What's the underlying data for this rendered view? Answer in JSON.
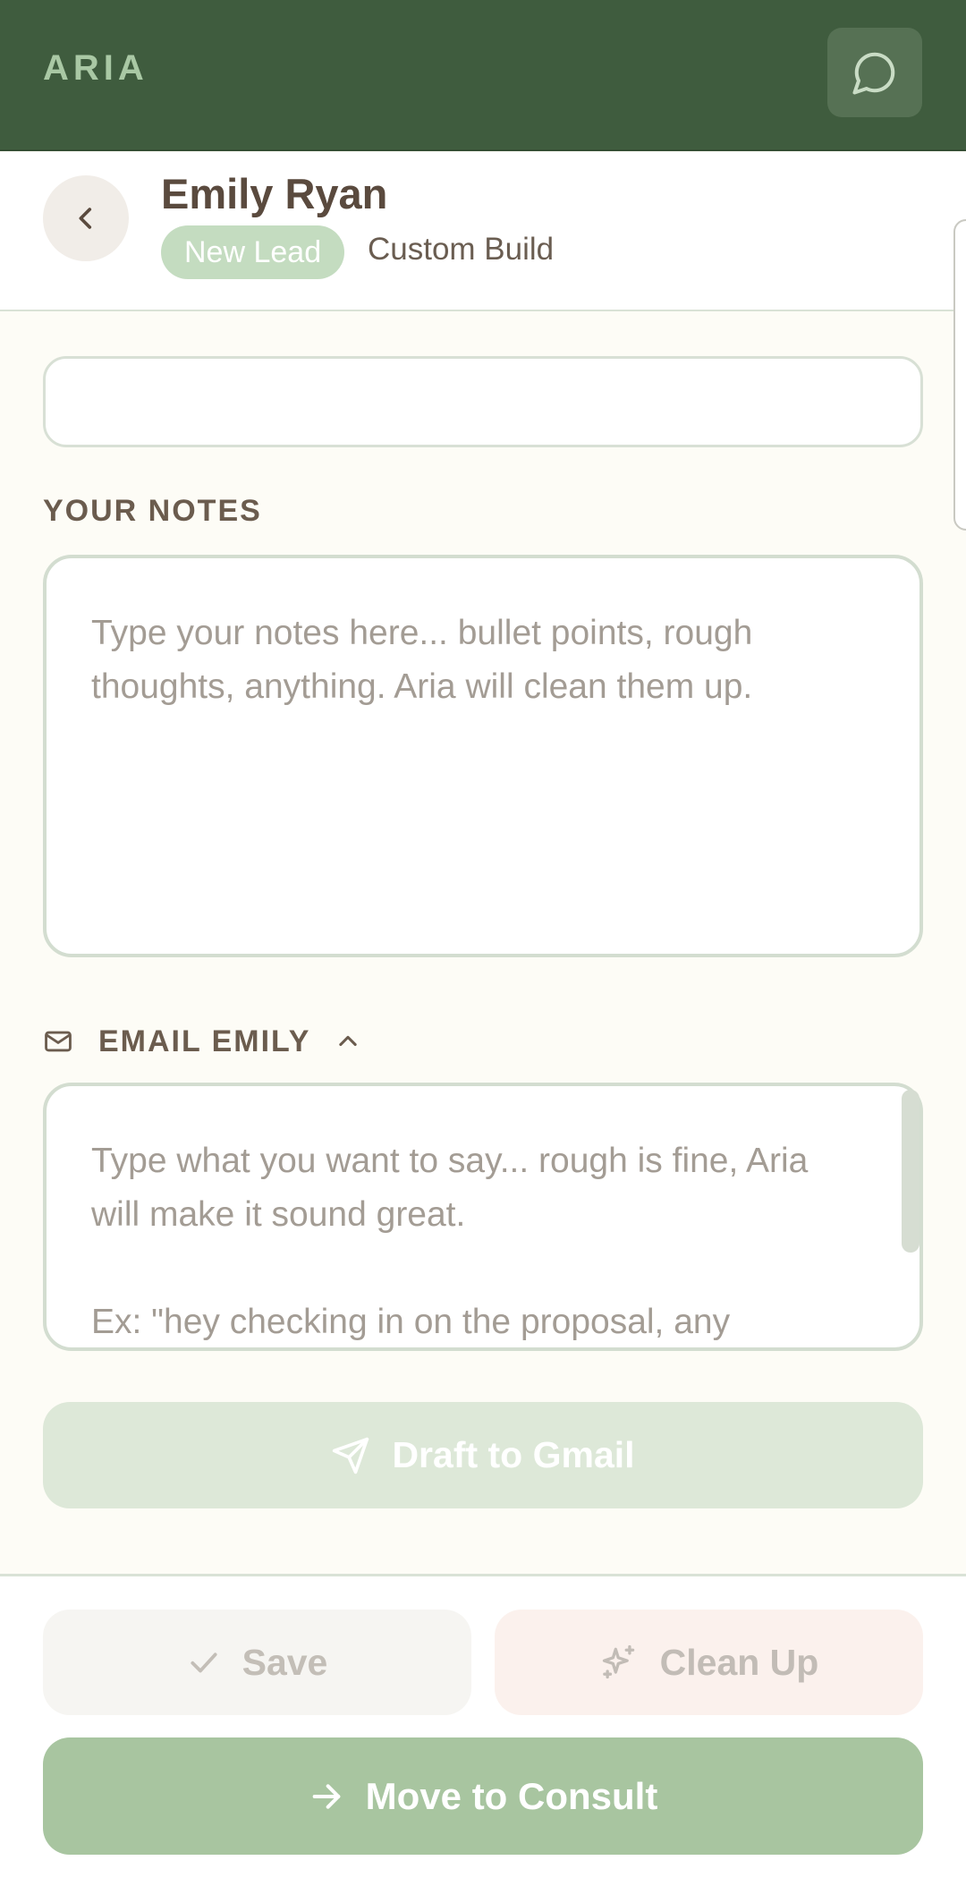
{
  "header": {
    "brand": "ARIA",
    "chat_icon": "chat-bubble-icon"
  },
  "lead": {
    "back_icon": "chevron-left-icon",
    "name": "Emily Ryan",
    "status": "New Lead",
    "project_type": "Custom Build"
  },
  "top_input": {
    "value": "",
    "placeholder": ""
  },
  "notes": {
    "label": "YOUR NOTES",
    "placeholder": "Type your notes here... bullet points, rough thoughts, anything. Aria will clean them up.",
    "value": ""
  },
  "email": {
    "icon": "mail-icon",
    "label": "EMAIL EMILY",
    "toggle_icon": "chevron-up-icon",
    "placeholder": "Type what you want to say... rough is fine, Aria will make it sound great.\n\nEx: \"hey checking in on the proposal, any",
    "value": "",
    "draft_label": "Draft to Gmail",
    "draft_icon": "send-icon"
  },
  "footer": {
    "save_label": "Save",
    "save_icon": "check-icon",
    "cleanup_label": "Clean Up",
    "cleanup_icon": "sparkles-icon",
    "consult_label": "Move to Consult",
    "consult_icon": "arrow-right-icon"
  },
  "colors": {
    "header_bg": "#3f5c3e",
    "brand": "#a9c8a4",
    "accent": "#a8c5a0",
    "badge": "#c4dcc0",
    "page_bg": "#fdfcf6"
  }
}
